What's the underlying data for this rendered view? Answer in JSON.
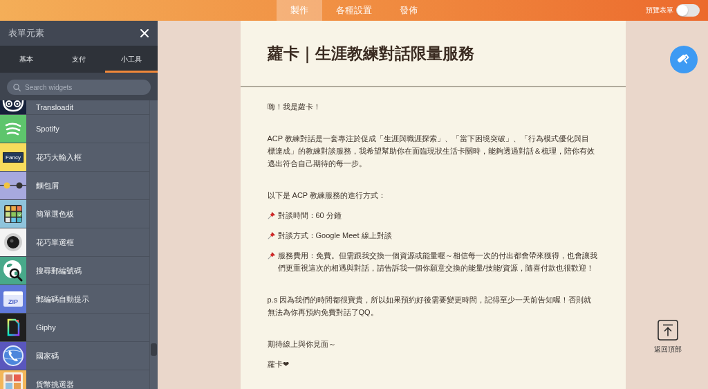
{
  "top_bar": {
    "tabs": [
      {
        "label": "製作",
        "selected": true
      },
      {
        "label": "各種設置",
        "selected": false
      },
      {
        "label": "發佈",
        "selected": false
      }
    ],
    "preview": {
      "label": "預覽表單",
      "on": false
    }
  },
  "sidebar": {
    "title": "表單元素",
    "tabs": [
      {
        "label": "基本",
        "selected": false
      },
      {
        "label": "支付",
        "selected": false
      },
      {
        "label": "小工具",
        "selected": true
      }
    ],
    "search": {
      "placeholder": "Search widgets"
    },
    "items": [
      {
        "label": "Transloadit",
        "color": "#16213a"
      },
      {
        "label": "Spotify",
        "color": "#5ec56c"
      },
      {
        "label": "花巧大輸入框",
        "color": "#f8dc5c",
        "icon_text": "Fancy"
      },
      {
        "label": "麵包屑",
        "color": "#a7a9de"
      },
      {
        "label": "簡單選色板",
        "color": "#8fc4dc"
      },
      {
        "label": "花巧單選框",
        "color": "#f4f4f4"
      },
      {
        "label": "搜尋郵編號碼",
        "color": "#48a98a"
      },
      {
        "label": "郵編碼自動提示",
        "color": "#6079d9",
        "icon_text": "ZIP"
      },
      {
        "label": "Giphy",
        "color": "#1f1f1f"
      },
      {
        "label": "國家碼",
        "color": "#5a57bd"
      },
      {
        "label": "貨幣挑選器",
        "color": "#f2b65a"
      }
    ]
  },
  "form": {
    "title": "蘿卡｜生涯教練對話限量服務",
    "sections": [
      [
        {
          "kind": "plain",
          "text": "嗨！我是蘿卡！"
        }
      ],
      [
        {
          "kind": "plain",
          "text": "ACP 教練對話是一套專注於促成「生涯與職涯探索」、「當下困境突破」、「行為模式優化與目標達成」的教練對談服務，我希望幫助你在面臨現狀生活卡關時，能夠透過對話＆梳理，陪你有效邁出符合自己期待的每一步。"
        }
      ],
      [
        {
          "kind": "plain",
          "text": "以下是 ACP 教練服務的進行方式："
        },
        {
          "kind": "pinned",
          "text": "對談時間：60 分鐘"
        },
        {
          "kind": "pinned",
          "text": "對談方式：Google Meet 線上對談"
        },
        {
          "kind": "pinned",
          "text": "服務費用：免費。但需跟我交換一個資源或能量喔～相信每一次的付出都會帶來獲得，也會讓我們更重視這次的相遇與對話，請告訴我一個你願意交換的能量/技能/資源，隨喜付款也很歡迎！"
        }
      ],
      [
        {
          "kind": "plain",
          "text": "p.s 因為我們的時間都很寶貴，所以如果預約好後需要變更時間，記得至少一天前告知喔！否則就無法為你再預約免費對話了QQ。"
        }
      ],
      [
        {
          "kind": "plain",
          "text": "期待線上與你見面～"
        },
        {
          "kind": "plain",
          "text": "蘿卡❤"
        }
      ]
    ]
  },
  "back_to_top": {
    "label": "返回頂部"
  }
}
